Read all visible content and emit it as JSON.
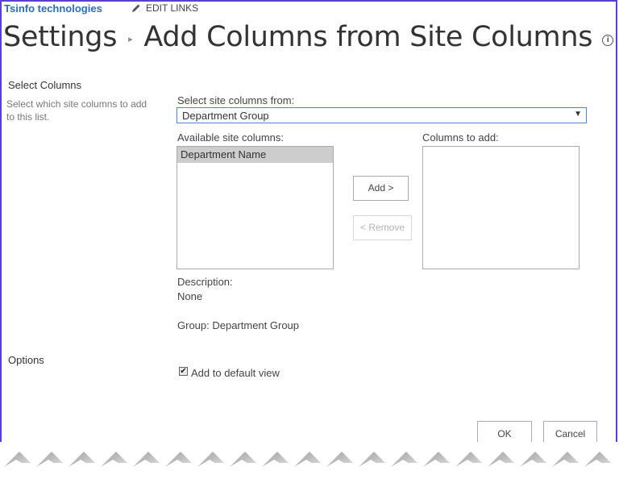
{
  "header": {
    "site_title": "Tsinfo technologies",
    "edit_links": "EDIT LINKS",
    "breadcrumb_root": "Settings",
    "page_title": "Add Columns from Site Columns"
  },
  "select_columns": {
    "title": "Select Columns",
    "description": "Select which site columns to add to this list.",
    "source_label": "Select site columns from:",
    "source_value": "Department Group",
    "available_label": "Available site columns:",
    "available_items": [
      "Department Name"
    ],
    "to_add_label": "Columns to add:",
    "add_button": "Add >",
    "remove_button": "< Remove",
    "description_label": "Description:",
    "description_value": "None",
    "group_text": "Group: Department Group"
  },
  "options": {
    "title": "Options",
    "add_default_view_label": "Add to default view",
    "add_default_view_checked": true
  },
  "footer": {
    "ok_button": "OK",
    "cancel_button": "Cancel"
  }
}
